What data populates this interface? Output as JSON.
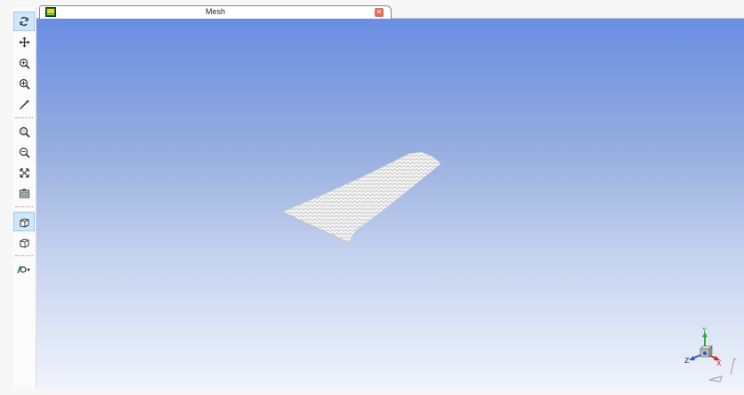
{
  "tab": {
    "title": "Mesh",
    "icon": "mesh-icon",
    "close_icon": "close-icon"
  },
  "toolbar": {
    "tools": [
      {
        "name": "rotate-icon",
        "active": true
      },
      {
        "name": "pan-icon",
        "active": false
      },
      {
        "name": "zoom-icon",
        "active": false
      },
      {
        "name": "zoom-box-icon",
        "active": false
      },
      {
        "name": "probe-icon",
        "active": false
      },
      {
        "name": "zoom-in-icon",
        "active": false
      },
      {
        "name": "zoom-out-icon",
        "active": false
      },
      {
        "name": "fit-all-icon",
        "active": false
      },
      {
        "name": "screenshot-icon",
        "active": false
      },
      {
        "name": "shaded-view-icon",
        "active": true
      },
      {
        "name": "wireframe-view-icon",
        "active": false
      },
      {
        "name": "display-options-icon",
        "active": false
      }
    ]
  },
  "viewport": {
    "background_top": "#6b8ee2",
    "background_bottom": "#eff3fb",
    "axes": {
      "x": "X",
      "y": "Y",
      "z": "Z"
    }
  }
}
